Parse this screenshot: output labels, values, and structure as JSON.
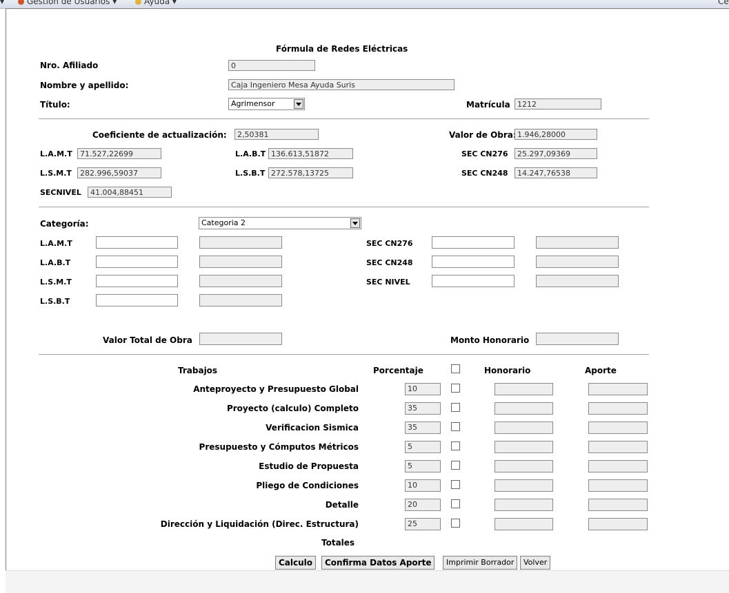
{
  "menubar": {
    "items": [
      "Gestion de Usuarios ▾",
      "Ayuda ▾"
    ],
    "right_text": "Ce"
  },
  "form": {
    "title": "Fórmula de Redes Eléctricas",
    "nro_afiliado_label": "Nro. Afiliado",
    "nro_afiliado_value": "0",
    "nombre_label": "Nombre y apellido:",
    "nombre_value": "Caja Ingeniero Mesa Ayuda Suris",
    "titulo_label": "Título:",
    "titulo_value": "Agrimensor",
    "matricula_label": "Matrícula",
    "matricula_value": "1212"
  },
  "coef": {
    "coef_label": "Coeficiente de actualización:",
    "coef_value": "2,50381",
    "valor_obra_label": "Valor de Obra:",
    "valor_obra_value": "1.946,28000",
    "lamt_label": "L.A.M.T",
    "lamt_value": "71.527,22699",
    "labt_label": "L.A.B.T",
    "labt_value": "136.613,51872",
    "sec276_label": "SEC CN276",
    "sec276_value": "25.297,09369",
    "lsmt_label": "L.S.M.T",
    "lsmt_value": "282.996,59037",
    "lsbt_label": "L.S.B.T",
    "lsbt_value": "272.578,13725",
    "sec248_label": "SEC CN248",
    "sec248_value": "14.247,76538",
    "secnivel_label": "SECNIVEL",
    "secnivel_value": "41.004,88451"
  },
  "categoria": {
    "label": "Categoría:",
    "value": "Categoria 2",
    "left_rows": [
      "L.A.M.T",
      "L.A.B.T",
      "L.S.M.T",
      "L.S.B.T"
    ],
    "right_rows": [
      "SEC CN276",
      "SEC CN248",
      "SEC NIVEL"
    ],
    "valor_total_label": "Valor Total de Obra",
    "monto_honorario_label": "Monto Honorario"
  },
  "trabajos": {
    "headers": {
      "trabajos": "Trabajos",
      "porcentaje": "Porcentaje",
      "honorario": "Honorario",
      "aporte": "Aporte"
    },
    "rows": [
      {
        "name": "Anteproyecto y Presupuesto Global",
        "pct": "10"
      },
      {
        "name": "Proyecto (calculo) Completo",
        "pct": "35"
      },
      {
        "name": "Verificacion Sismica",
        "pct": "35"
      },
      {
        "name": "Presupuesto y Cómputos Métricos",
        "pct": "5"
      },
      {
        "name": "Estudio de Propuesta",
        "pct": "5"
      },
      {
        "name": "Pliego de Condiciones",
        "pct": "10"
      },
      {
        "name": "Detalle",
        "pct": "20"
      },
      {
        "name": "Dirección y Liquidación (Direc. Estructura)",
        "pct": "25"
      }
    ],
    "totales_label": "Totales"
  },
  "buttons": {
    "calculo": "Calculo",
    "confirma": "Confirma Datos Aporte",
    "imprimir": "Imprimir Borrador",
    "volver": "Volver"
  }
}
